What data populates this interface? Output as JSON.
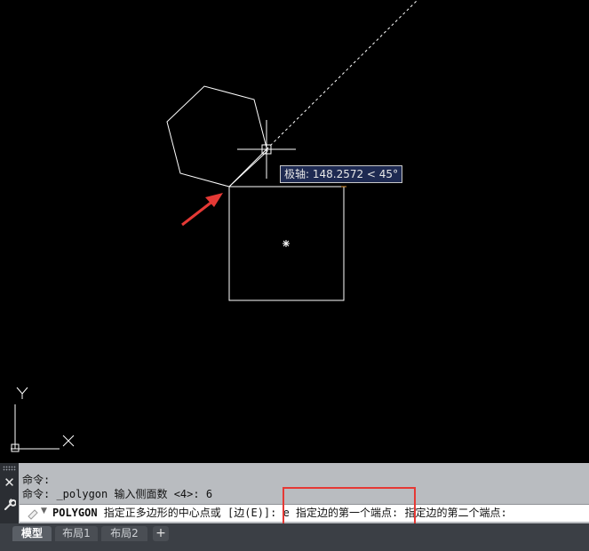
{
  "drawing": {
    "polar_tooltip": "极轴: 148.2572 < 45°",
    "ucs_y_label": "Y",
    "ucs_x_label": "X"
  },
  "command_line": {
    "history": [
      "命令:",
      "命令: _polygon 输入侧面数 <4>: 6"
    ],
    "prompt_command": "POLYGON",
    "prompt_text": " 指定正多边形的中心点或 [边(E)]: e 指定边的第一个端点: 指定边的第二个端点:"
  },
  "layout_tabs": [
    "模型",
    "布局1",
    "布局2"
  ],
  "add_tab_label": "+",
  "colors": {
    "canvas": "#000000",
    "geometry": "#ffffff",
    "annotation_arrow": "#e53935",
    "highlight_box": "#e53935",
    "tooltip_bg": "#1e2a52"
  },
  "icons": [
    "close-icon",
    "wrench-icon",
    "command-icon",
    "chevron-down-icon",
    "add-icon"
  ]
}
